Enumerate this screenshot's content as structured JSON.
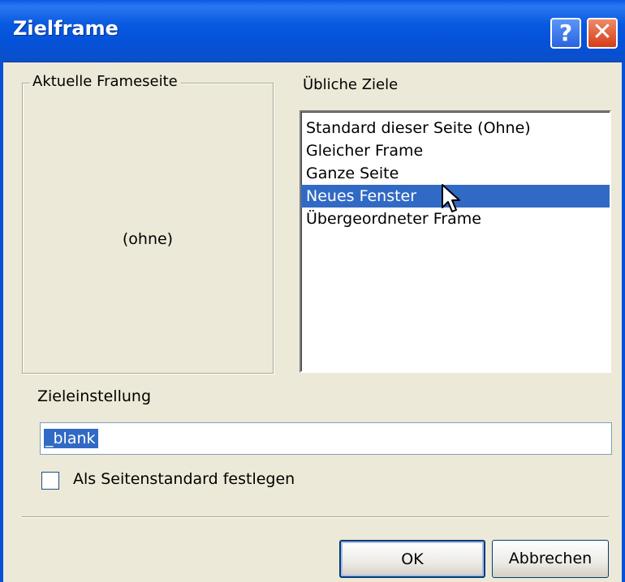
{
  "window": {
    "title": "Zielframe",
    "help_label": "?",
    "close_label": "✕"
  },
  "current_frame": {
    "legend": "Aktuelle Frameseite",
    "value": "(ohne)"
  },
  "common_targets": {
    "label": "Übliche Ziele",
    "items": [
      "Standard dieser Seite (Ohne)",
      "Gleicher Frame",
      "Ganze Seite",
      "Neues Fenster",
      "Übergeordneter Frame"
    ],
    "selected": "Neues Fenster"
  },
  "target_setting": {
    "label": "Zieleinstellung",
    "value": "_blank"
  },
  "page_default": {
    "label": "Als Seitenstandard festlegen",
    "checked": false
  },
  "buttons": {
    "ok": "OK",
    "cancel": "Abbrechen"
  },
  "colors": {
    "titlebar": "#0552d8",
    "selection": "#316ac5",
    "dialog_bg": "#ece9d8"
  }
}
